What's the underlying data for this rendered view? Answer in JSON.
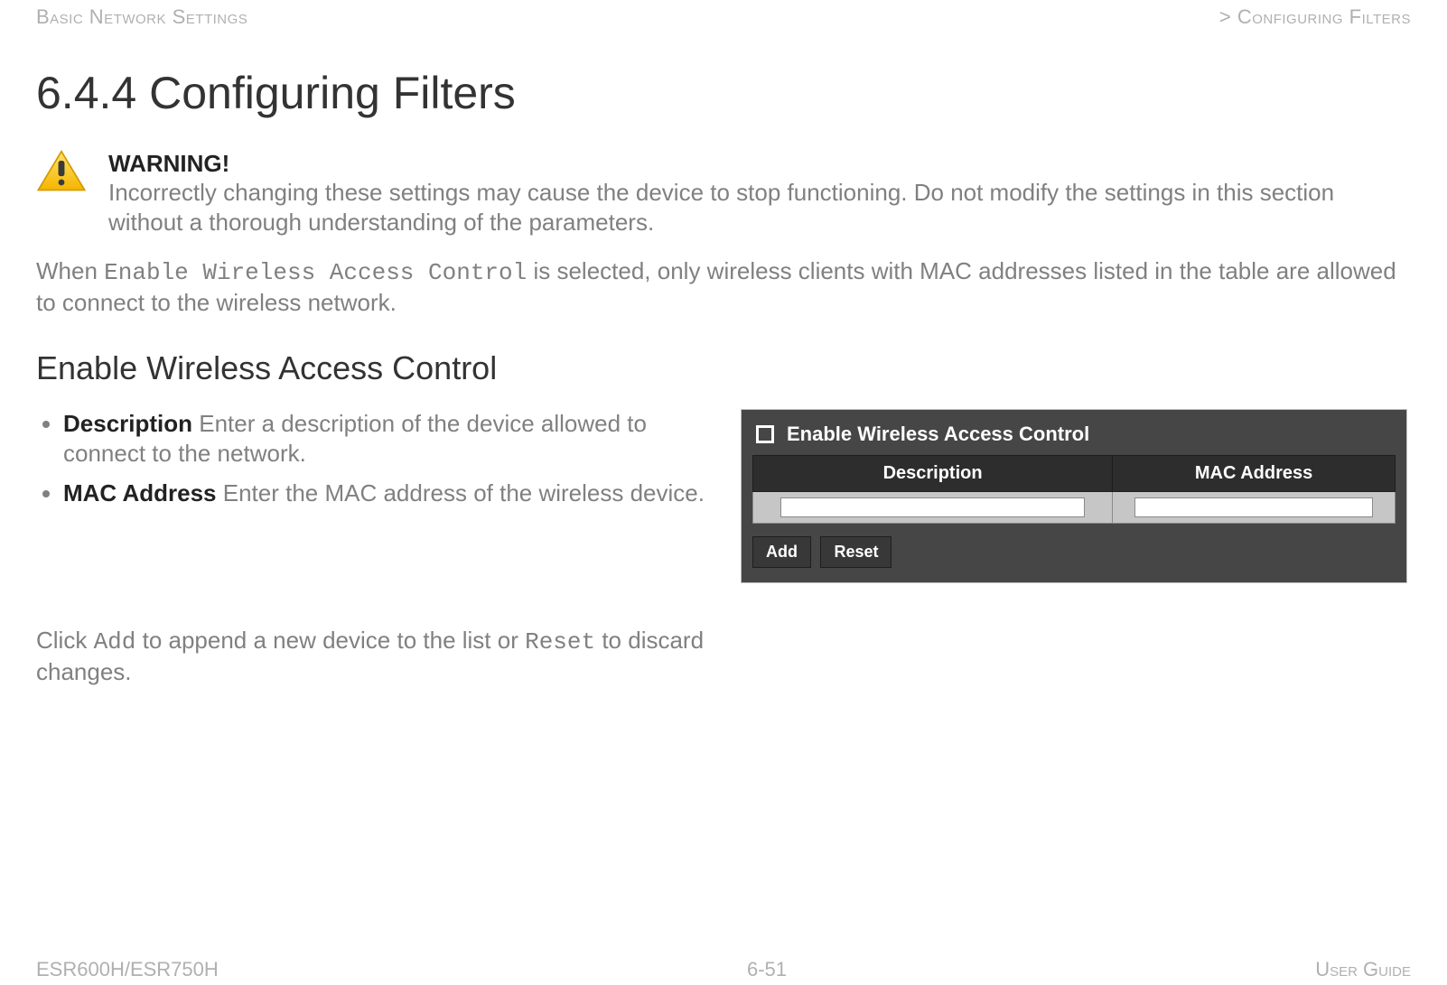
{
  "header": {
    "left": "Basic Network Settings",
    "right": "> Configuring Filters"
  },
  "heading": "6.4.4 Configuring Filters",
  "warning": {
    "label": "WARNING!",
    "body": "Incorrectly changing these settings may cause the device to stop functioning. Do not modify the settings in this section without a thorough understanding of the parameters."
  },
  "intro": {
    "pre": "When ",
    "code": "Enable Wireless Access Control",
    "post": " is selected, only wireless clients with MAC addresses listed in the table are allowed to connect to the wireless network."
  },
  "subheading": "Enable Wireless Access Control",
  "bullets": [
    {
      "term": "Description",
      "body": "  Enter a description of the device allowed to connect to the network."
    },
    {
      "term": "MAC Address",
      "body": "  Enter the MAC address of the wireless device."
    }
  ],
  "click_note": {
    "t1": "Click ",
    "code1": "Add",
    "t2": " to append a new device to the list or ",
    "code2": "Reset",
    "t3": " to discard changes."
  },
  "panel": {
    "checkbox_label": "Enable Wireless Access Control",
    "th_description": "Description",
    "th_mac": "MAC Address",
    "btn_add": "Add",
    "btn_reset": "Reset"
  },
  "footer": {
    "model": "ESR600H/ESR750H",
    "page": "6-51",
    "guide": "User Guide"
  }
}
